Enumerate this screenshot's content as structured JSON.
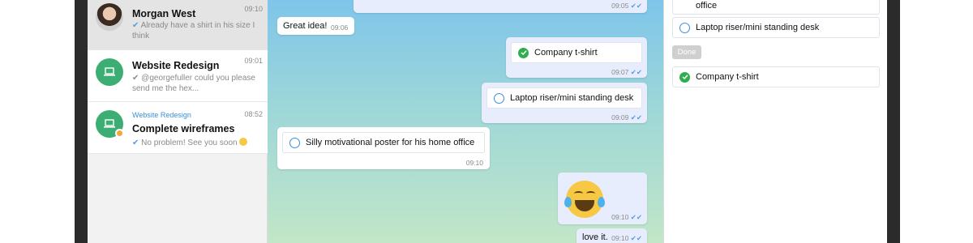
{
  "chats": [
    {
      "name": "Morgan West",
      "time": "09:10",
      "preview_tick": "✔",
      "preview": "Already have a shirt in his size I think"
    },
    {
      "name": "Website Redesign",
      "time": "09:01",
      "preview_tick": "✔",
      "preview": "@georgefuller could you please send me the hex..."
    },
    {
      "group_label": "Website Redesign",
      "name": "Complete wireframes",
      "time": "08:52",
      "preview_tick": "✔",
      "preview": "No problem! See you soon"
    }
  ],
  "messages": {
    "top_out_time": "09:05",
    "great_idea": {
      "text": "Great idea!",
      "time": "09:06"
    },
    "company_tshirt": {
      "text": "Company t-shirt",
      "time": "09:07"
    },
    "laptop_riser": {
      "text": "Laptop riser/mini standing desk",
      "time": "09:09"
    },
    "silly_poster": {
      "text": "Silly motivational poster for his home office",
      "time": "09:10"
    },
    "emoji": {
      "time": "09:10"
    },
    "love_it": {
      "text": "love it.",
      "time": "09:10"
    }
  },
  "panel": {
    "item_office": "office",
    "item_laptop": "Laptop riser/mini standing desk",
    "done_label": "Done",
    "item_company": "Company t-shirt"
  },
  "colors": {
    "accent": "#3d8de0",
    "group_green": "#3cae73",
    "checked_green": "#2fae4e"
  },
  "icons": {
    "read_tick": "✔✔",
    "sent_tick": "✔"
  }
}
